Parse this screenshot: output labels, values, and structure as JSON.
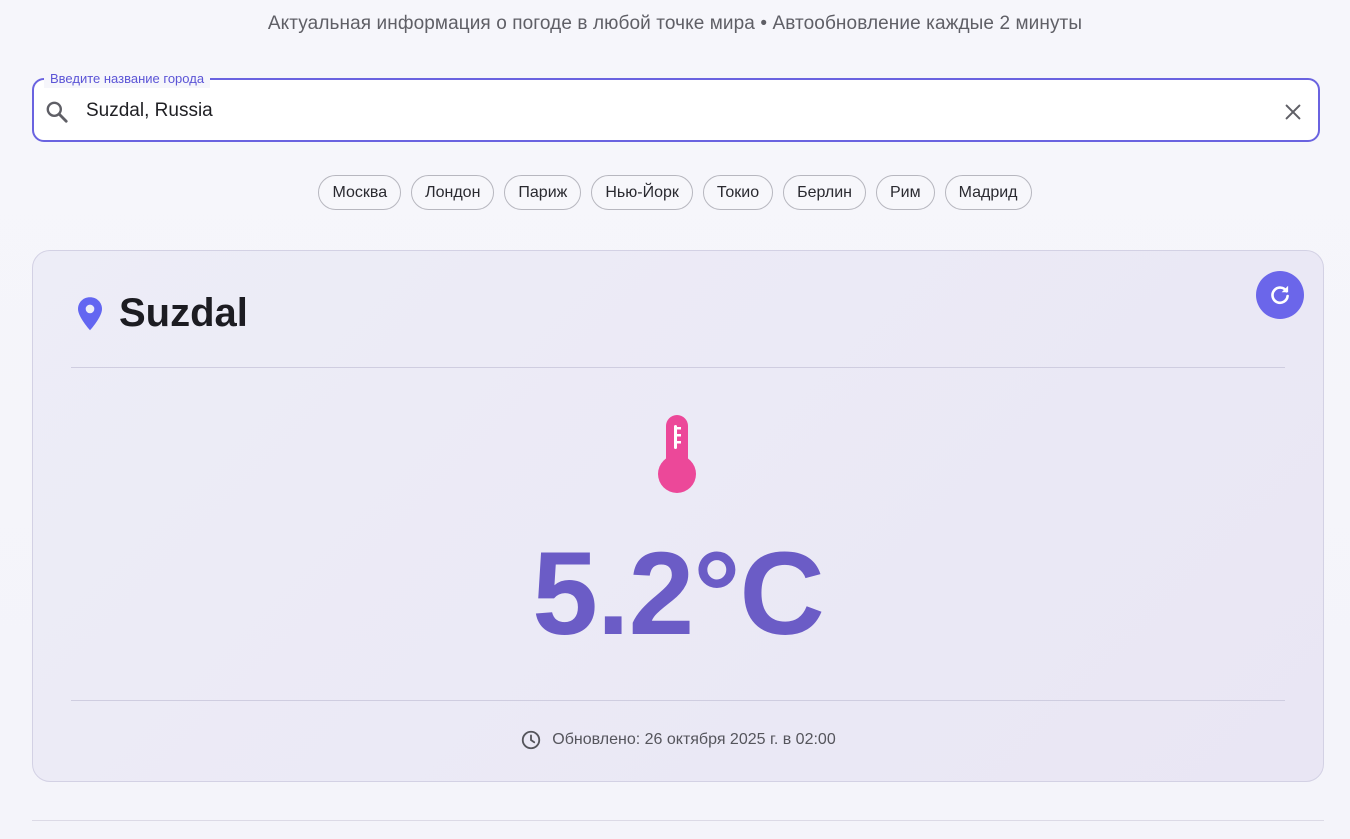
{
  "header": {
    "subtitle": "Актуальная информация о погоде в любой точке мира • Автообновление каждые 2 минуты"
  },
  "search": {
    "label": "Введите название города",
    "value": "Suzdal, Russia",
    "icon": "search-icon",
    "clear_icon": "close-icon"
  },
  "quick_cities": [
    "Москва",
    "Лондон",
    "Париж",
    "Нью-Йорк",
    "Токио",
    "Берлин",
    "Рим",
    "Мадрид"
  ],
  "weather_card": {
    "city": "Suzdal",
    "temperature": "5.2°C",
    "updated": "Обновлено: 26 октября 2025 г. в 02:00",
    "icons": {
      "location": "map-pin-icon",
      "temperature": "thermometer-icon",
      "refresh": "refresh-icon",
      "time": "clock-icon"
    }
  },
  "colors": {
    "accent": "#6b66ea",
    "temperature_text": "#6b5cc6",
    "thermometer": "#ec4899",
    "pin": "#6366f1"
  }
}
